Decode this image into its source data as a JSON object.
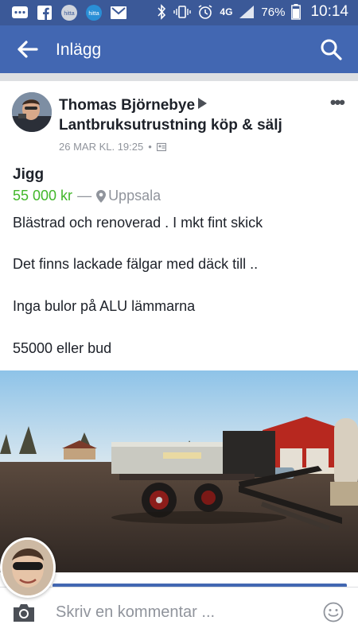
{
  "status_bar": {
    "battery": "76%",
    "time": "10:14",
    "network": "4G"
  },
  "app_bar": {
    "title": "Inlägg"
  },
  "post": {
    "author": "Thomas Björnebye",
    "group": "Lantbruksutrustning köp & sälj",
    "timestamp": "26 MAR KL. 19:25",
    "meta_sep": "•",
    "item_title": "Jigg",
    "price": "55 000 kr",
    "dash": "—",
    "location": "Uppsala",
    "lines": [
      "Blästrad och renoverad . I mkt fint skick",
      "Det finns lackade fälgar med däck till ..",
      "Inga bulor på ALU lämmarna",
      "55000 eller bud"
    ],
    "more": "•••"
  },
  "comment_bar": {
    "placeholder": "Skriv en kommentar ..."
  },
  "colors": {
    "status_bar": "#3b5998",
    "app_bar": "#4267b2",
    "price": "#42b72a",
    "meta": "#90949c"
  }
}
